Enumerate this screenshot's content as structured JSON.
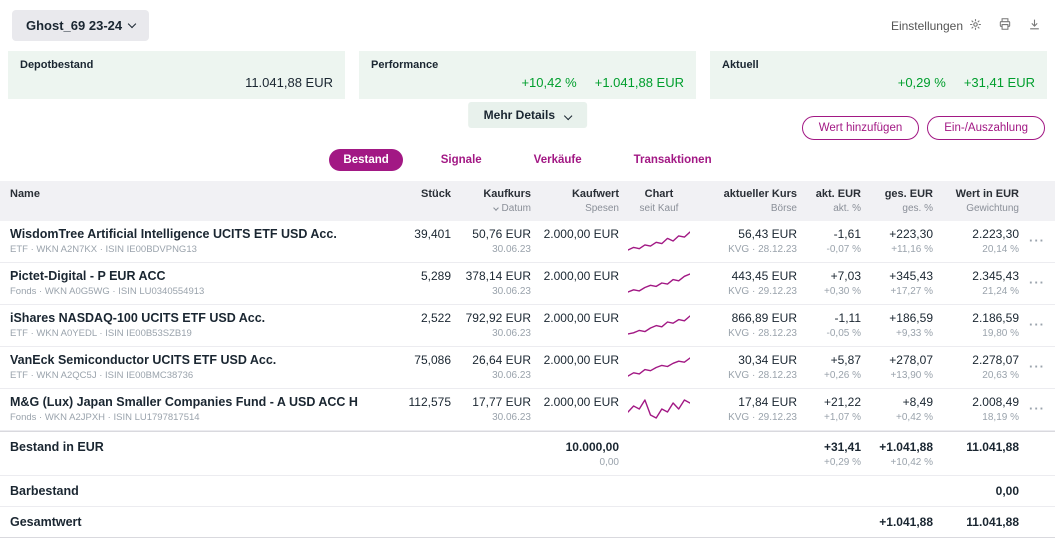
{
  "header": {
    "portfolio_name": "Ghost_69 23-24",
    "settings_label": "Einstellungen"
  },
  "summary": {
    "depotbestand": {
      "label": "Depotbestand",
      "value": "11.041,88 EUR"
    },
    "performance": {
      "label": "Performance",
      "pct": "+10,42 %",
      "value": "+1.041,88 EUR"
    },
    "aktuell": {
      "label": "Aktuell",
      "pct": "+0,29 %",
      "value": "+31,41 EUR"
    }
  },
  "controls": {
    "mehr_details": "Mehr Details",
    "wert_hinzufuegen": "Wert hinzufügen",
    "ein_auszahlung": "Ein-/Auszahlung"
  },
  "tabs": [
    {
      "label": "Bestand"
    },
    {
      "label": "Signale"
    },
    {
      "label": "Verkäufe"
    },
    {
      "label": "Transaktionen"
    }
  ],
  "icons": {
    "ellipsis": "···"
  },
  "colors": {
    "accent": "#a21884",
    "positive": "#009e2d",
    "negative": "#e60028",
    "card_bg": "#edf5f0"
  },
  "table": {
    "headers": {
      "name": "Name",
      "stueck": "Stück",
      "kaufkurs": "Kaufkurs",
      "kaufkurs_sub": "Datum",
      "kaufwert": "Kaufwert",
      "kaufwert_sub": "Spesen",
      "chart": "Chart",
      "chart_sub": "seit Kauf",
      "akt_kurs": "aktueller Kurs",
      "akt_kurs_sub": "Börse",
      "akt_eur": "akt. EUR",
      "akt_eur_sub": "akt. %",
      "ges_eur": "ges. EUR",
      "ges_eur_sub": "ges. %",
      "wert": "Wert in EUR",
      "wert_sub": "Gewichtung"
    },
    "rows": [
      {
        "name": "WisdomTree Artificial Intelligence UCITS ETF USD Acc.",
        "meta": "ETF · WKN A2N7KX · ISIN IE00BDVPNG13",
        "stueck": "39,401",
        "kaufkurs": "50,76 EUR",
        "kauf_datum": "30.06.23",
        "kaufwert": "2.000,00 EUR",
        "akt_kurs": "56,43 EUR",
        "boerse": "KVG · 28.12.23",
        "akt_eur": "-1,61",
        "akt_pct": "-0,07 %",
        "akt_cls": "neg",
        "ges_eur": "+223,30",
        "ges_pct": "+11,16 %",
        "ges_cls": "pos",
        "wert": "2.223,30",
        "gewichtung": "20,14 %",
        "spark": [
          3,
          5,
          4,
          7,
          6,
          9,
          8,
          12,
          10,
          14,
          13,
          17
        ]
      },
      {
        "name": "Pictet-Digital - P EUR ACC",
        "meta": "Fonds · WKN A0G5WG · ISIN LU0340554913",
        "stueck": "5,289",
        "kaufkurs": "378,14 EUR",
        "kauf_datum": "30.06.23",
        "kaufwert": "2.000,00 EUR",
        "akt_kurs": "443,45 EUR",
        "boerse": "KVG · 29.12.23",
        "akt_eur": "+7,03",
        "akt_pct": "+0,30 %",
        "akt_cls": "pos",
        "ges_eur": "+345,43",
        "ges_pct": "+17,27 %",
        "ges_cls": "pos",
        "wert": "2.345,43",
        "gewichtung": "21,24 %",
        "spark": [
          2,
          4,
          3,
          6,
          8,
          7,
          10,
          9,
          13,
          12,
          16,
          18
        ]
      },
      {
        "name": "iShares NASDAQ-100 UCITS ETF USD Acc.",
        "meta": "ETF · WKN A0YEDL · ISIN IE00B53SZB19",
        "stueck": "2,522",
        "kaufkurs": "792,92 EUR",
        "kauf_datum": "30.06.23",
        "kaufwert": "2.000,00 EUR",
        "akt_kurs": "866,89 EUR",
        "boerse": "KVG · 28.12.23",
        "akt_eur": "-1,11",
        "akt_pct": "-0,05 %",
        "akt_cls": "neg",
        "ges_eur": "+186,59",
        "ges_pct": "+9,33 %",
        "ges_cls": "pos",
        "wert": "2.186,59",
        "gewichtung": "19,80 %",
        "spark": [
          3,
          4,
          6,
          5,
          8,
          10,
          9,
          13,
          12,
          15,
          14,
          18
        ]
      },
      {
        "name": "VanEck Semiconductor UCITS ETF USD Acc.",
        "meta": "ETF · WKN A2QC5J · ISIN IE00BMC38736",
        "stueck": "75,086",
        "kaufkurs": "26,64 EUR",
        "kauf_datum": "30.06.23",
        "kaufwert": "2.000,00 EUR",
        "akt_kurs": "30,34 EUR",
        "boerse": "KVG · 28.12.23",
        "akt_eur": "+5,87",
        "akt_pct": "+0,26 %",
        "akt_cls": "pos",
        "ges_eur": "+278,07",
        "ges_pct": "+13,90 %",
        "ges_cls": "pos",
        "wert": "2.278,07",
        "gewichtung": "20,63 %",
        "spark": [
          2,
          5,
          4,
          8,
          7,
          10,
          12,
          11,
          14,
          16,
          15,
          19
        ]
      },
      {
        "name": "M&G (Lux) Japan Smaller Companies Fund - A USD ACC H",
        "meta": "Fonds · WKN A2JPXH · ISIN LU1797817514",
        "stueck": "112,575",
        "kaufkurs": "17,77 EUR",
        "kauf_datum": "30.06.23",
        "kaufwert": "2.000,00 EUR",
        "akt_kurs": "17,84 EUR",
        "boerse": "KVG · 29.12.23",
        "akt_eur": "+21,22",
        "akt_pct": "+1,07 %",
        "akt_cls": "pos",
        "ges_eur": "+8,49",
        "ges_pct": "+0,42 %",
        "ges_cls": "pos",
        "wert": "2.008,49",
        "gewichtung": "18,19 %",
        "spark": [
          8,
          10,
          9,
          12,
          7,
          6,
          9,
          8,
          11,
          9,
          12,
          11
        ]
      }
    ],
    "totals": {
      "bestand": {
        "label": "Bestand in EUR",
        "kaufwert": "10.000,00",
        "spesen": "0,00",
        "akt_eur": "+31,41",
        "akt_pct": "+0,29 %",
        "ges_eur": "+1.041,88",
        "ges_pct": "+10,42 %",
        "wert": "11.041,88"
      },
      "barbestand": {
        "label": "Barbestand",
        "wert": "0,00"
      },
      "gesamtwert": {
        "label": "Gesamtwert",
        "ges_eur": "+1.041,88",
        "wert": "11.041,88"
      }
    }
  }
}
